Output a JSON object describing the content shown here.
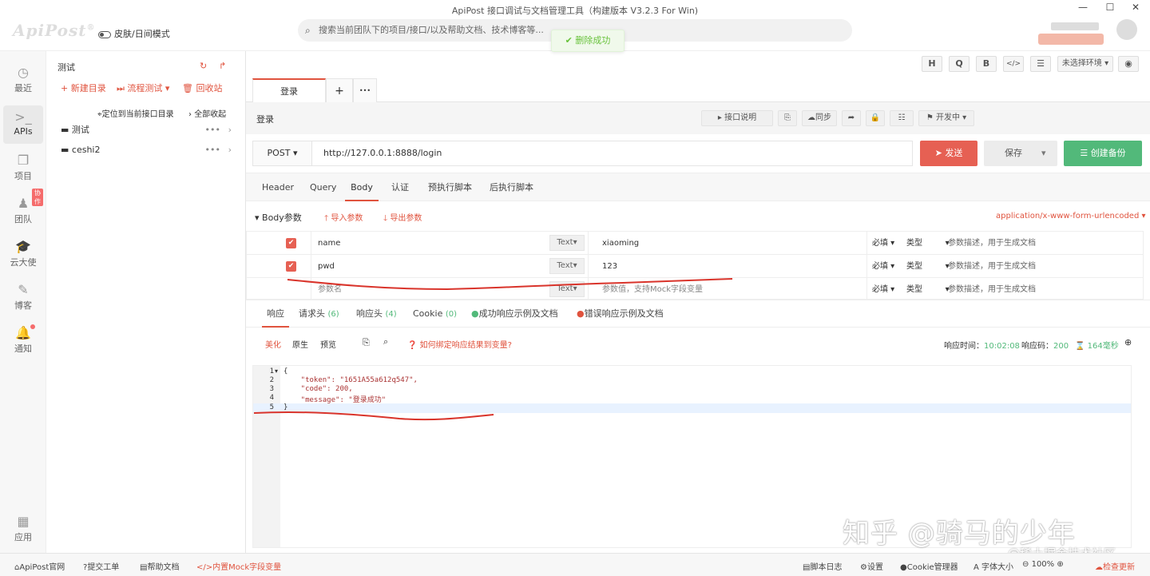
{
  "window": {
    "title": "ApiPost 接口调试与文档管理工具（构建版本 V3.2.3 For Win)",
    "min": "—",
    "max": "☐",
    "close": "✕"
  },
  "header": {
    "logo": "ApiPost",
    "logo_mark": "®",
    "skin_label": "皮肤/日间模式",
    "search_placeholder": "搜索当前团队下的项目/接口/以及帮助文档、技术博客等...",
    "toast": "删除成功"
  },
  "rail": {
    "items": [
      {
        "label": "最近",
        "icon": "clock-icon"
      },
      {
        "label": "APIs",
        "icon": "terminal-icon"
      },
      {
        "label": "项目",
        "icon": "layers-icon"
      },
      {
        "label": "团队",
        "icon": "team-icon",
        "badge": "协作"
      },
      {
        "label": "云大使",
        "icon": "graduation-cap-icon"
      },
      {
        "label": "博客",
        "icon": "edit-icon"
      },
      {
        "label": "通知",
        "icon": "bell-icon"
      },
      {
        "label": "应用",
        "icon": "apps-icon"
      }
    ]
  },
  "tree": {
    "title": "测试",
    "new_dir": "新建目录",
    "flow_test": "流程测试",
    "recycle": "回收站",
    "locate": "定位到当前接口目录",
    "collapse": "全部收起",
    "folders": [
      "测试",
      "ceshi2"
    ]
  },
  "toolbar": {
    "h": "H",
    "q": "Q",
    "b": "B",
    "code": "</>",
    "env": "未选择环境"
  },
  "tabs": {
    "active": "登录",
    "add": "+",
    "more": "•••"
  },
  "api": {
    "name": "登录",
    "doc_btn": "接口说明",
    "sync": "同步",
    "status": "开发中"
  },
  "request": {
    "method": "POST",
    "url": "http://127.0.0.1:8888/login",
    "send": "发送",
    "save": "保存",
    "backup": "创建备份"
  },
  "req_tabs": [
    "Header",
    "Query",
    "Body",
    "认证",
    "预执行脚本",
    "后执行脚本"
  ],
  "body": {
    "title": "Body参数",
    "import": "导入参数",
    "export": "导出参数",
    "content_type": "application/x-www-form-urlencoded",
    "params": [
      {
        "name": "name",
        "type": "Text",
        "value": "xiaoming",
        "required": "必填",
        "ptype": "类型",
        "desc": "参数描述，用于生成文档"
      },
      {
        "name": "pwd",
        "type": "Text",
        "value": "123",
        "required": "必填",
        "ptype": "类型",
        "desc": "参数描述，用于生成文档"
      },
      {
        "name": "参数名",
        "type": "Text",
        "value": "参数值，支持Mock字段变量",
        "required": "必填",
        "ptype": "类型",
        "desc": "参数描述，用于生成文档"
      }
    ]
  },
  "resp_tabs": {
    "response": "响应",
    "req_headers": "请求头",
    "req_headers_count": "(6)",
    "resp_headers": "响应头",
    "resp_headers_count": "(4)",
    "cookie": "Cookie",
    "cookie_count": "(0)",
    "success_example": "成功响应示例及文档",
    "error_example": "错误响应示例及文档"
  },
  "resp_bar": {
    "beautify": "美化",
    "raw": "原生",
    "preview": "预览",
    "help": "如何绑定响应结果到变量?",
    "time_label": "响应时间：",
    "time": "10:02:08",
    "code_label": "响应码：",
    "code": "200",
    "duration": "164毫秒"
  },
  "code_lines": [
    {
      "n": "1",
      "text": "{"
    },
    {
      "n": "2",
      "text": "    \"token\": \"1651A55a612q547\","
    },
    {
      "n": "3",
      "text": "    \"code\": 200,"
    },
    {
      "n": "4",
      "text": "    \"message\": \"登录成功\""
    },
    {
      "n": "5",
      "text": "}"
    }
  ],
  "status_bar": {
    "site": "ApiPost官网",
    "ticket": "提交工单",
    "help": "帮助文档",
    "mock": "内置Mock字段变量",
    "script_log": "脚本日志",
    "settings": "设置",
    "cookie": "Cookie管理器",
    "font": "字体大小",
    "zoom": "100%",
    "update": "检查更新"
  },
  "watermark": {
    "main": "知乎 @骑马的少年",
    "sub": "@稀土掘金技术社区"
  }
}
